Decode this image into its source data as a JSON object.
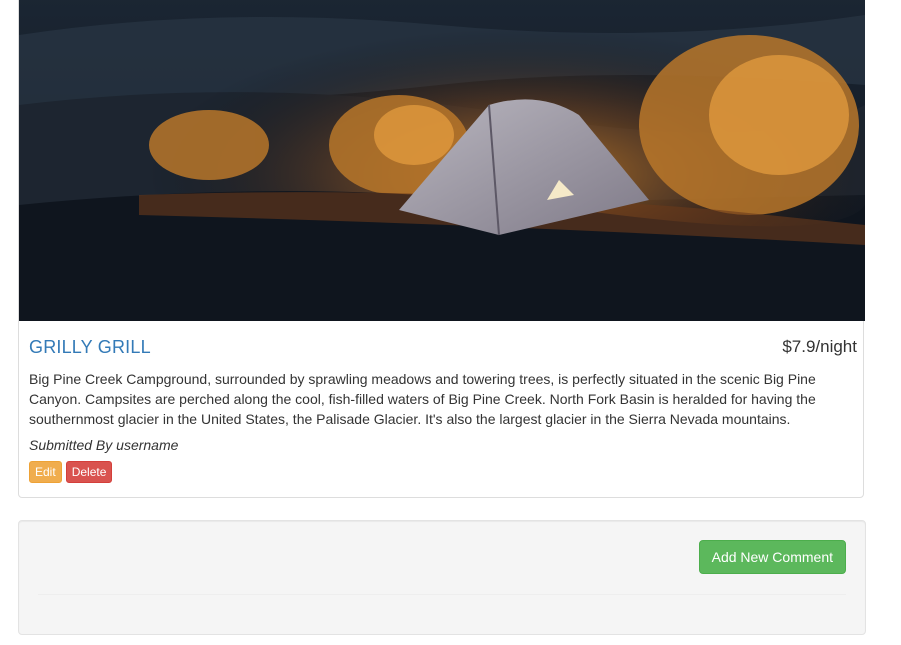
{
  "campground": {
    "image_alt": "Tent in a canyon at dusk",
    "name": "GRILLY GRILL",
    "price": "$7.9/night",
    "description": "Big Pine Creek Campground, surrounded by sprawling meadows and towering trees, is perfectly situated in the scenic Big Pine Canyon. Campsites are perched along the cool, fish-filled waters of Big Pine Creek. North Fork Basin is heralded for having the southernmost glacier in the United States, the Palisade Glacier. It's also the largest glacier in the Sierra Nevada mountains.",
    "submitted_by": "Submitted By username",
    "edit_label": "Edit",
    "delete_label": "Delete"
  },
  "comments": {
    "add_button_label": "Add New Comment"
  },
  "colors": {
    "link": "#337ab7",
    "warning": "#f0ad4e",
    "danger": "#d9534f",
    "success": "#5cb85c",
    "well_bg": "#f5f5f5"
  }
}
